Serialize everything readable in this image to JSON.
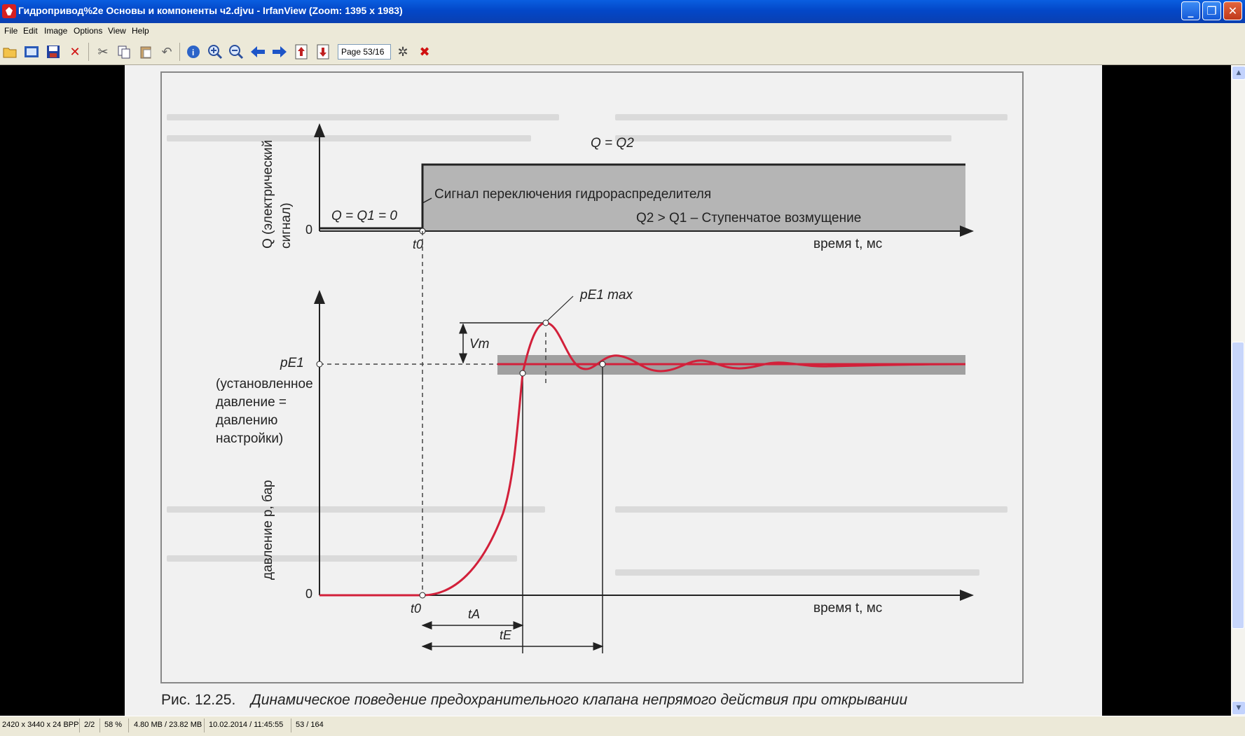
{
  "window": {
    "title": "Гидропривод%2e Основы и компоненты ч2.djvu - IrfanView (Zoom: 1395 x 1983)",
    "minimize": "_",
    "maximize": "❐",
    "close": "✕"
  },
  "menu": [
    "File",
    "Edit",
    "Image",
    "Options",
    "View",
    "Help"
  ],
  "toolbar": {
    "page_field": "Page 53/16",
    "icons": [
      "open-folder-icon",
      "thumbnails-icon",
      "save-icon",
      "delete-icon",
      "cut-icon",
      "copy-icon",
      "paste-icon",
      "undo-icon",
      "info-icon",
      "zoom-in-icon",
      "zoom-out-icon",
      "previous-icon",
      "next-icon",
      "page-up-icon",
      "page-down-icon",
      "properties-icon",
      "exit-icon"
    ]
  },
  "figure": {
    "top": {
      "ylabel_line1": "Q (электрический",
      "ylabel_line2": "сигнал)",
      "origin": "0",
      "t0": "t0",
      "label_q2": "Q = Q2",
      "label_q1": "Q = Q1 = 0",
      "signal_label": "Сигнал переключения гидрораспределителя",
      "disturbance": "Q2 > Q1 – Ступенчатое возмущение",
      "xlabel": "время t, мс"
    },
    "bottom": {
      "ylabel": "давление p, бар",
      "origin": "0",
      "t0": "t0",
      "pe1": "pE1",
      "pe1_note": [
        "(установленное",
        "давление =",
        "давлению",
        "настройки)"
      ],
      "pe1max": "pE1 max",
      "vm": "Vm",
      "ta": "tA",
      "te": "tE",
      "xlabel": "время t, мс"
    },
    "caption_prefix": "Рис. 12.25.",
    "caption_text": "Динамическое поведение предохранительного клапана непрямого действия при открывании"
  },
  "status": {
    "dimensions": "2420 x 3440 x 24 BPP",
    "frame": "2/2",
    "zoom": "58 %",
    "memory": "4.80 MB / 23.82 MB",
    "datetime": "10.02.2014 / 11:45:55",
    "page": "53 / 164"
  },
  "colors": {
    "curve": "#d2203a",
    "band": "#9a9a9a",
    "titlebar": "#0347c8"
  }
}
